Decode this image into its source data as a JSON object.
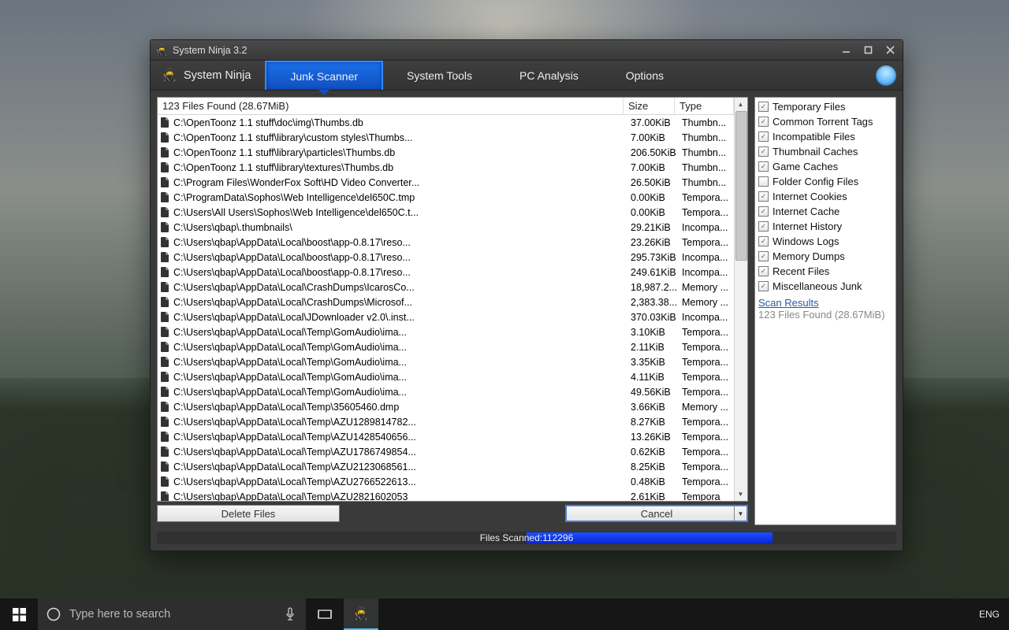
{
  "window": {
    "title": "System Ninja 3.2",
    "brand": "System Ninja",
    "tabs": [
      "Junk Scanner",
      "System Tools",
      "PC Analysis",
      "Options"
    ],
    "active_tab_index": 0
  },
  "list": {
    "summary": "123 Files Found (28.67MiB)",
    "headers": {
      "path_implicit": "",
      "size": "Size",
      "type": "Type"
    },
    "rows": [
      {
        "path": "C:\\OpenToonz 1.1 stuff\\doc\\img\\Thumbs.db",
        "size": "37.00KiB",
        "type": "Thumbn..."
      },
      {
        "path": "C:\\OpenToonz 1.1 stuff\\library\\custom styles\\Thumbs...",
        "size": "7.00KiB",
        "type": "Thumbn..."
      },
      {
        "path": "C:\\OpenToonz 1.1 stuff\\library\\particles\\Thumbs.db",
        "size": "206.50KiB",
        "type": "Thumbn..."
      },
      {
        "path": "C:\\OpenToonz 1.1 stuff\\library\\textures\\Thumbs.db",
        "size": "7.00KiB",
        "type": "Thumbn..."
      },
      {
        "path": "C:\\Program Files\\WonderFox Soft\\HD Video Converter...",
        "size": "26.50KiB",
        "type": "Thumbn..."
      },
      {
        "path": "C:\\ProgramData\\Sophos\\Web Intelligence\\del650C.tmp",
        "size": "0.00KiB",
        "type": "Tempora..."
      },
      {
        "path": "C:\\Users\\All Users\\Sophos\\Web Intelligence\\del650C.t...",
        "size": "0.00KiB",
        "type": "Tempora..."
      },
      {
        "path": "C:\\Users\\qbap\\.thumbnails\\",
        "size": "29.21KiB",
        "type": "Incompa..."
      },
      {
        "path": "C:\\Users\\qbap\\AppData\\Local\\boost\\app-0.8.17\\reso...",
        "size": "23.26KiB",
        "type": "Tempora..."
      },
      {
        "path": "C:\\Users\\qbap\\AppData\\Local\\boost\\app-0.8.17\\reso...",
        "size": "295.73KiB",
        "type": "Incompa..."
      },
      {
        "path": "C:\\Users\\qbap\\AppData\\Local\\boost\\app-0.8.17\\reso...",
        "size": "249.61KiB",
        "type": "Incompa..."
      },
      {
        "path": "C:\\Users\\qbap\\AppData\\Local\\CrashDumps\\IcarosCo...",
        "size": "18,987.2...",
        "type": "Memory ..."
      },
      {
        "path": "C:\\Users\\qbap\\AppData\\Local\\CrashDumps\\Microsof...",
        "size": "2,383.38...",
        "type": "Memory ..."
      },
      {
        "path": "C:\\Users\\qbap\\AppData\\Local\\JDownloader v2.0\\.inst...",
        "size": "370.03KiB",
        "type": "Incompa..."
      },
      {
        "path": "C:\\Users\\qbap\\AppData\\Local\\Temp\\GomAudio\\ima...",
        "size": "3.10KiB",
        "type": "Tempora..."
      },
      {
        "path": "C:\\Users\\qbap\\AppData\\Local\\Temp\\GomAudio\\ima...",
        "size": "2.11KiB",
        "type": "Tempora..."
      },
      {
        "path": "C:\\Users\\qbap\\AppData\\Local\\Temp\\GomAudio\\ima...",
        "size": "3.35KiB",
        "type": "Tempora..."
      },
      {
        "path": "C:\\Users\\qbap\\AppData\\Local\\Temp\\GomAudio\\ima...",
        "size": "4.11KiB",
        "type": "Tempora..."
      },
      {
        "path": "C:\\Users\\qbap\\AppData\\Local\\Temp\\GomAudio\\ima...",
        "size": "49.56KiB",
        "type": "Tempora..."
      },
      {
        "path": "C:\\Users\\qbap\\AppData\\Local\\Temp\\35605460.dmp",
        "size": "3.66KiB",
        "type": "Memory ..."
      },
      {
        "path": "C:\\Users\\qbap\\AppData\\Local\\Temp\\AZU1289814782...",
        "size": "8.27KiB",
        "type": "Tempora..."
      },
      {
        "path": "C:\\Users\\qbap\\AppData\\Local\\Temp\\AZU1428540656...",
        "size": "13.26KiB",
        "type": "Tempora..."
      },
      {
        "path": "C:\\Users\\qbap\\AppData\\Local\\Temp\\AZU1786749854...",
        "size": "0.62KiB",
        "type": "Tempora..."
      },
      {
        "path": "C:\\Users\\qbap\\AppData\\Local\\Temp\\AZU2123068561...",
        "size": "8.25KiB",
        "type": "Tempora..."
      },
      {
        "path": "C:\\Users\\qbap\\AppData\\Local\\Temp\\AZU2766522613...",
        "size": "0.48KiB",
        "type": "Tempora..."
      },
      {
        "path": "C:\\Users\\qbap\\AppData\\Local\\Temp\\AZU2821602053",
        "size": "2.61KiB",
        "type": "Tempora"
      }
    ]
  },
  "buttons": {
    "delete": "Delete Files",
    "cancel": "Cancel"
  },
  "categories": [
    {
      "label": "Temporary Files",
      "checked": true
    },
    {
      "label": "Common Torrent Tags",
      "checked": true
    },
    {
      "label": "Incompatible Files",
      "checked": true
    },
    {
      "label": "Thumbnail Caches",
      "checked": true
    },
    {
      "label": "Game Caches",
      "checked": true
    },
    {
      "label": "Folder Config Files",
      "checked": false
    },
    {
      "label": "Internet Cookies",
      "checked": true
    },
    {
      "label": "Internet Cache",
      "checked": true
    },
    {
      "label": "Internet History",
      "checked": true
    },
    {
      "label": "Windows Logs",
      "checked": true
    },
    {
      "label": "Memory Dumps",
      "checked": true
    },
    {
      "label": "Recent Files",
      "checked": true
    },
    {
      "label": "Miscellaneous Junk",
      "checked": true
    }
  ],
  "scan": {
    "results_link": "Scan Results",
    "results_info": "123 Files Found (28.67MiB)"
  },
  "status": {
    "label": "Files Scanned:",
    "count": "112296"
  },
  "taskbar": {
    "search_placeholder": "Type here to search",
    "language": "ENG"
  }
}
